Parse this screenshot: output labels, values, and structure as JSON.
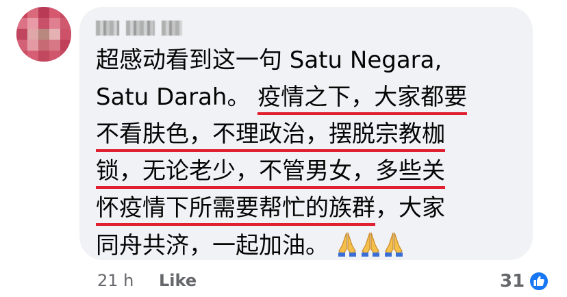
{
  "comment": {
    "author_name": "",
    "lines": [
      "超感动看到这一句 Satu Negara,",
      "Satu Darah。 ",
      "疫情之下，大家都要",
      "不看肤色，不理政治，摆脱宗教枷",
      "锁，无论老少，不管男女，多些关",
      "怀疫情下所需要帮忙的族群",
      "，大家",
      "同舟共济，一起加油。"
    ],
    "emoji": [
      "folded-hands",
      "folded-hands",
      "folded-hands"
    ]
  },
  "footer": {
    "timestamp": "21 h",
    "like_label": "Like",
    "reaction_count": "31"
  },
  "colors": {
    "bubble": "#f0f2f5",
    "underline": "#e02030",
    "like_blue": "#1877f2",
    "meta_gray": "#65676b"
  }
}
